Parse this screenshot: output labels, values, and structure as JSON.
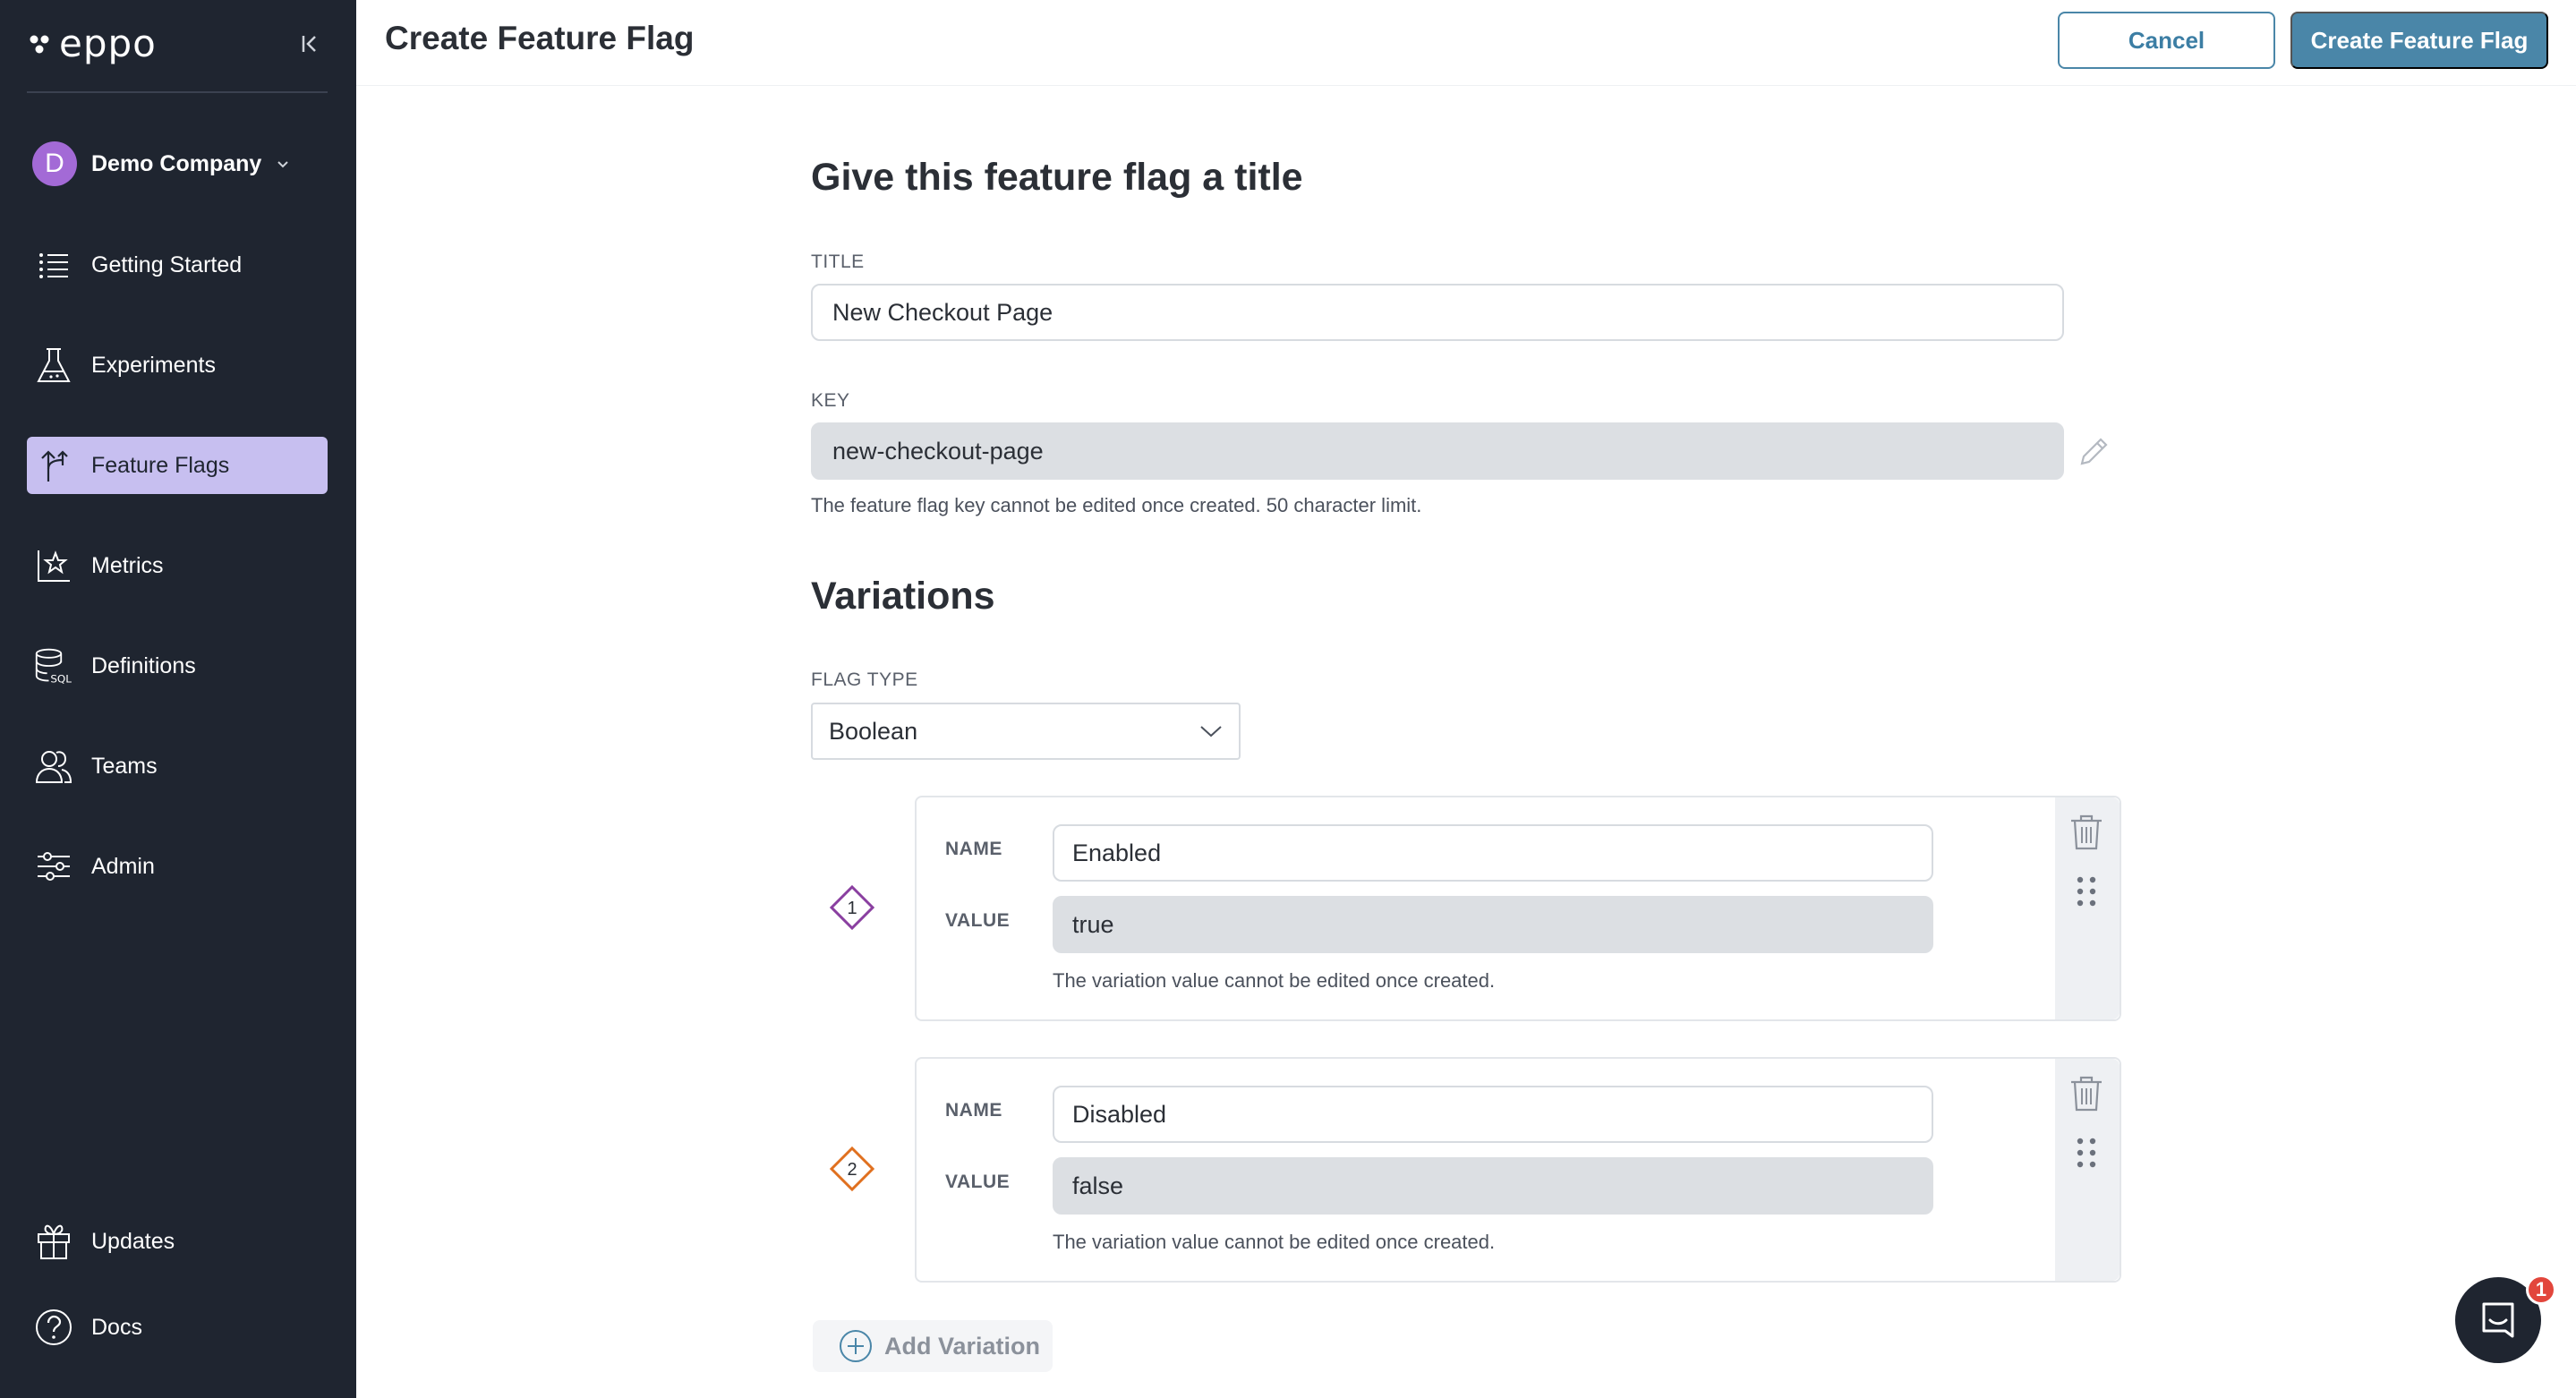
{
  "app": {
    "logo_text": "eppo"
  },
  "sidebar": {
    "company": {
      "initial": "D",
      "name": "Demo Company"
    },
    "items": [
      {
        "label": "Getting Started",
        "icon": "list-icon"
      },
      {
        "label": "Experiments",
        "icon": "flask-icon"
      },
      {
        "label": "Feature Flags",
        "icon": "flag-branch-icon",
        "active": true
      },
      {
        "label": "Metrics",
        "icon": "chart-star-icon"
      },
      {
        "label": "Definitions",
        "icon": "database-sql-icon"
      },
      {
        "label": "Teams",
        "icon": "people-icon"
      },
      {
        "label": "Admin",
        "icon": "sliders-icon"
      }
    ],
    "bottom_items": [
      {
        "label": "Updates",
        "icon": "gift-icon"
      },
      {
        "label": "Docs",
        "icon": "help-circle-icon"
      }
    ]
  },
  "header": {
    "title": "Create Feature Flag",
    "cancel_label": "Cancel",
    "create_label": "Create Feature Flag"
  },
  "form": {
    "section_title": "Give this feature flag a title",
    "title_label": "TITLE",
    "title_value": "New Checkout Page",
    "key_label": "KEY",
    "key_value": "new-checkout-page",
    "key_help": "The feature flag key cannot be edited once created. 50 character limit."
  },
  "variations": {
    "section_title": "Variations",
    "flag_type_label": "FLAG TYPE",
    "flag_type_value": "Boolean",
    "name_label": "NAME",
    "value_label": "VALUE",
    "value_help": "The variation value cannot be edited once created.",
    "items": [
      {
        "index": "1",
        "name": "Enabled",
        "value": "true",
        "color": "#8a3fa0"
      },
      {
        "index": "2",
        "name": "Disabled",
        "value": "false",
        "color": "#e0701f"
      }
    ],
    "add_label": "Add Variation"
  },
  "chat": {
    "badge": "1"
  },
  "colors": {
    "sidebar_bg": "#1f2530",
    "active_nav": "#c7bff0",
    "primary": "#4a86a8",
    "avatar": "#a36ad6",
    "badge": "#e2463c"
  }
}
